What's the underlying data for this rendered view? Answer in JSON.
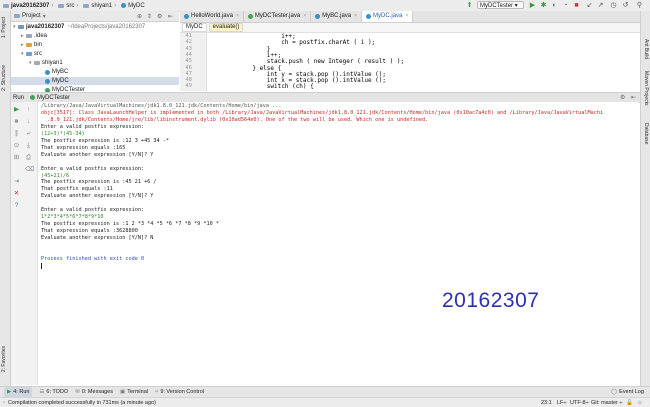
{
  "navbar": {
    "project": "java20162307",
    "path": [
      "src",
      "shiyan1",
      "MyDC"
    ],
    "run_config": "MyDCTester"
  },
  "project_panel": {
    "dropdown": "Project",
    "tree": [
      {
        "label": "java20162307",
        "suffix": "~/IdeaProjects/java20162307",
        "depth": 0,
        "type": "module",
        "expanded": true
      },
      {
        "label": ".idea",
        "depth": 1,
        "type": "folder",
        "expanded": false
      },
      {
        "label": "bin",
        "depth": 1,
        "type": "folder",
        "expanded": false
      },
      {
        "label": "src",
        "depth": 1,
        "type": "folder",
        "expanded": true
      },
      {
        "label": "shiyan1",
        "depth": 2,
        "type": "package",
        "expanded": true
      },
      {
        "label": "MyBC",
        "depth": 3,
        "type": "class"
      },
      {
        "label": "MyDC",
        "depth": 3,
        "type": "class",
        "selected": true
      },
      {
        "label": "MyDCTester",
        "depth": 3,
        "type": "main"
      }
    ]
  },
  "editor": {
    "tabs": [
      {
        "label": "HelloWorld.java",
        "active": false
      },
      {
        "label": "MyDCTester.java",
        "active": false
      },
      {
        "label": "MyBC.java",
        "active": false
      },
      {
        "label": "MyDC.java",
        "active": true
      }
    ],
    "breadcrumbs": [
      "MyDC",
      "evaluate()"
    ],
    "lines": [
      {
        "num": "41",
        "text": "                    i++;"
      },
      {
        "num": "42",
        "text": "                    ch = postfix.charAt ( i );"
      },
      {
        "num": "43",
        "text": "                }"
      },
      {
        "num": "44",
        "text": "                i++;"
      },
      {
        "num": "45",
        "text": "                stack.push ( new Integer ( result ) );"
      },
      {
        "num": "46",
        "text": "            } else {"
      },
      {
        "num": "47",
        "text": "                int y = stack.pop ().intValue ();"
      },
      {
        "num": "48",
        "text": "                int x = stack.pop ().intValue ();"
      },
      {
        "num": "49",
        "text": "                switch (ch) {"
      }
    ]
  },
  "run_panel": {
    "label": "Run",
    "config": "MyDCTester",
    "console": [
      {
        "text": "/Library/Java/JavaVirtualMachines/jdk1.8.0_121.jdk/Contents/Home/bin/java ...",
        "style": "gray"
      },
      {
        "text": "objc[3517]: Class JavaLaunchHelper is implemented in both /Library/Java/JavaVirtualMachines/jdk1.8.0_121.jdk/Contents/Home/bin/java (0x10ac7a4c0) and /Library/Java/JavaVirtualMachi",
        "style": "red"
      },
      {
        "text": "  .8.0_121.jdk/Contents/Home/jre/lib/libinstrument.dylib (0x10ad564e0). One of the two will be used. Which one is undefined.",
        "style": "red"
      },
      {
        "text": "Enter a valid postfix expression:",
        "style": "normal"
      },
      {
        "text": "(12+3)*(45-34)",
        "style": "green"
      },
      {
        "text": "The postfix expression is :12 3 +45 34 -*",
        "style": "normal"
      },
      {
        "text": "That expression equals :165",
        "style": "normal"
      },
      {
        "text": "Evaluate another expression [Y/N]? Y",
        "style": "normal"
      },
      {
        "text": "",
        "style": "normal"
      },
      {
        "text": "Enter a valid postfix expression:",
        "style": "normal"
      },
      {
        "text": "(45+21)/6",
        "style": "green"
      },
      {
        "text": "The postfix expression is :45 21 +6 /",
        "style": "normal"
      },
      {
        "text": "That postfix equals :11",
        "style": "normal"
      },
      {
        "text": "Evaluate another expression [Y/N]? Y",
        "style": "normal"
      },
      {
        "text": "",
        "style": "normal"
      },
      {
        "text": "Enter a valid postfix expression:",
        "style": "normal"
      },
      {
        "text": "1*2*3*4*5*6*7*8*9*10",
        "style": "green"
      },
      {
        "text": "The postfix expression is :1 2 *3 *4 *5 *6 *7 *8 *9 *10 *",
        "style": "normal"
      },
      {
        "text": "That expression equals :3628800",
        "style": "normal"
      },
      {
        "text": "Evaluate another expression [Y/N]? N",
        "style": "normal"
      },
      {
        "text": "",
        "style": "normal"
      },
      {
        "text": "",
        "style": "normal"
      },
      {
        "text": "Process finished with exit code 0",
        "style": "blue"
      }
    ],
    "watermark": "20162307"
  },
  "bottom_tabs": [
    "4: Run",
    "6: TODO",
    "0: Messages",
    "Terminal",
    "9: Version Control"
  ],
  "event_log": "Event Log",
  "side_tabs": {
    "left": [
      "1: Project",
      "2: Structure",
      "2: Favorites"
    ],
    "right": [
      "Ant Build",
      "Maven Projects",
      "Database"
    ]
  },
  "status": {
    "message": "Compilation completed successfully in 731ms (a minute ago)",
    "position": "23:1",
    "line_sep": "LF÷",
    "encoding": "UTF-8÷",
    "git": "Git: master ÷"
  },
  "colors": {
    "accent": "#2a5db0",
    "watermark": "#2d2fb5",
    "error": "#c22a22",
    "input": "#2e8b2e"
  }
}
